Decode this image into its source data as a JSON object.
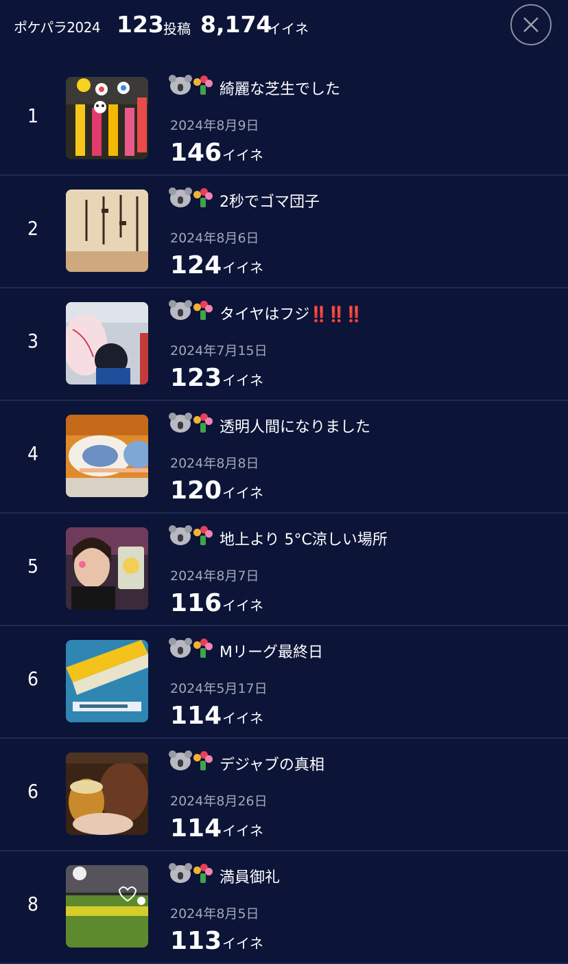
{
  "header": {
    "title": "ポケパラ2024",
    "posts_count": "123",
    "posts_label": "投稿",
    "likes_count": "8,174",
    "likes_label": "イイネ"
  },
  "icons": {
    "close": "close-icon",
    "koala": "koala-emoji-icon",
    "bouquet": "bouquet-emoji-icon"
  },
  "colors": {
    "background": "#0c1438",
    "divider": "#1e2a52",
    "date_text": "#a3a8b8",
    "exclamation": "#e8202a"
  },
  "posts": [
    {
      "rank": "1",
      "title": "綺麗な芝生でした",
      "date": "2024年8月9日",
      "likes": "146",
      "likes_label": "イイネ"
    },
    {
      "rank": "2",
      "title": "2秒でゴマ団子",
      "date": "2024年8月6日",
      "likes": "124",
      "likes_label": "イイネ"
    },
    {
      "rank": "3",
      "title": "タイヤはフジ",
      "title_suffix": "‼️‼️‼️",
      "date": "2024年7月15日",
      "likes": "123",
      "likes_label": "イイネ"
    },
    {
      "rank": "4",
      "title": "透明人間になりました",
      "date": "2024年8月8日",
      "likes": "120",
      "likes_label": "イイネ"
    },
    {
      "rank": "5",
      "title": "地上より 5°C涼しい場所",
      "date": "2024年8月7日",
      "likes": "116",
      "likes_label": "イイネ"
    },
    {
      "rank": "6",
      "title": "Mリーグ最終日",
      "date": "2024年5月17日",
      "likes": "114",
      "likes_label": "イイネ"
    },
    {
      "rank": "6",
      "title": "デジャブの真相",
      "date": "2024年8月26日",
      "likes": "114",
      "likes_label": "イイネ"
    },
    {
      "rank": "8",
      "title": "満員御礼",
      "date": "2024年8月5日",
      "likes": "113",
      "likes_label": "イイネ"
    }
  ]
}
